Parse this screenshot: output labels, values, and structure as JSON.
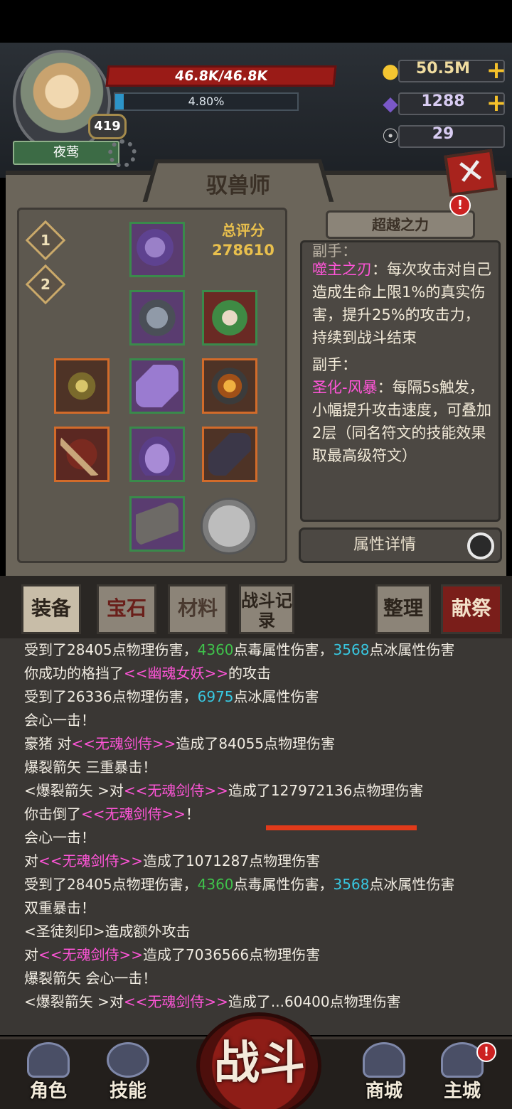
{
  "player": {
    "name": "夜莺",
    "level": "419",
    "hp": "46.8K/46.8K",
    "xp_text": "4.80%",
    "xp_fraction": 0.048
  },
  "resources": {
    "gold": "50.5M",
    "gems": "1288",
    "horns": "29",
    "plus": "+"
  },
  "panel": {
    "title": "驭兽师",
    "close_glyph": "✕",
    "score_label": "总评分",
    "score_value": "278610",
    "tiers": [
      "1",
      "2"
    ],
    "transcend_label": "超越之力",
    "alert": "!",
    "attr_label": "属性详情"
  },
  "skills": {
    "partial_header": "副手：",
    "s1_name": "噬主之刃",
    "s1_desc": "：每次攻击对自己造成生命上限1%的真实伤害，提升25%的攻击力，持续到战斗结束",
    "s2_header": "副手：",
    "s2_name": "圣化-风暴",
    "s2_desc": "：每隔5s触发，小幅提升攻击速度，可叠加2层（同名符文的技能效果取最高级符文）"
  },
  "tabs": {
    "equip": "装备",
    "gem": "宝石",
    "material": "材料",
    "battle_log": "战斗记录",
    "sort": "整理",
    "sacrifice": "献祭"
  },
  "log": [
    {
      "parts": [
        {
          "t": "受到了28405点物理伤害，"
        },
        {
          "t": "4360",
          "c": "green"
        },
        {
          "t": "点毒属性伤害，"
        },
        {
          "t": "3568",
          "c": "cyan"
        },
        {
          "t": "点冰属性伤害"
        }
      ]
    },
    {
      "parts": [
        {
          "t": "你成功的格挡了"
        },
        {
          "t": "<<幽魂女妖>>",
          "c": "pink"
        },
        {
          "t": "的攻击"
        }
      ]
    },
    {
      "parts": [
        {
          "t": "受到了26336点物理伤害，"
        },
        {
          "t": "6975",
          "c": "cyan"
        },
        {
          "t": "点冰属性伤害"
        }
      ]
    },
    {
      "parts": [
        {
          "t": "会心一击！"
        }
      ]
    },
    {
      "parts": [
        {
          "t": "豪猪 对"
        },
        {
          "t": "<<无魂剑侍>>",
          "c": "pink"
        },
        {
          "t": "造成了84055点物理伤害"
        }
      ]
    },
    {
      "parts": [
        {
          "t": "爆裂箭矢 三重暴击！"
        }
      ]
    },
    {
      "parts": [
        {
          "t": "<爆裂箭矢 >对"
        },
        {
          "t": "<<无魂剑侍>>",
          "c": "pink"
        },
        {
          "t": "造成了127972136点物理伤害"
        }
      ]
    },
    {
      "parts": [
        {
          "t": "你击倒了"
        },
        {
          "t": "<<无魂剑侍>>",
          "c": "pink"
        },
        {
          "t": "！"
        }
      ]
    },
    {
      "parts": [
        {
          "t": "会心一击！"
        }
      ]
    },
    {
      "parts": [
        {
          "t": "对"
        },
        {
          "t": "<<无魂剑侍>>",
          "c": "pink"
        },
        {
          "t": "造成了1071287点物理伤害"
        }
      ]
    },
    {
      "parts": [
        {
          "t": "受到了28405点物理伤害，"
        },
        {
          "t": "4360",
          "c": "green"
        },
        {
          "t": "点毒属性伤害，"
        },
        {
          "t": "3568",
          "c": "cyan"
        },
        {
          "t": "点冰属性伤害"
        }
      ]
    },
    {
      "parts": [
        {
          "t": "双重暴击！"
        }
      ]
    },
    {
      "parts": [
        {
          "t": "<圣徒刻印>造成额外攻击"
        }
      ]
    },
    {
      "parts": [
        {
          "t": "对"
        },
        {
          "t": "<<无魂剑侍>>",
          "c": "pink"
        },
        {
          "t": "造成了7036566点物理伤害"
        }
      ]
    },
    {
      "parts": [
        {
          "t": "爆裂箭矢 会心一击！"
        }
      ]
    },
    {
      "parts": [
        {
          "t": "<爆裂箭矢 >对"
        },
        {
          "t": "<<无魂剑侍>>",
          "c": "pink"
        },
        {
          "t": "造成了...60400点物理伤害"
        }
      ]
    }
  ],
  "nav": {
    "character": "角色",
    "skills": "技能",
    "battle": "战斗",
    "shop": "商城",
    "city": "主城",
    "alert": "!"
  }
}
